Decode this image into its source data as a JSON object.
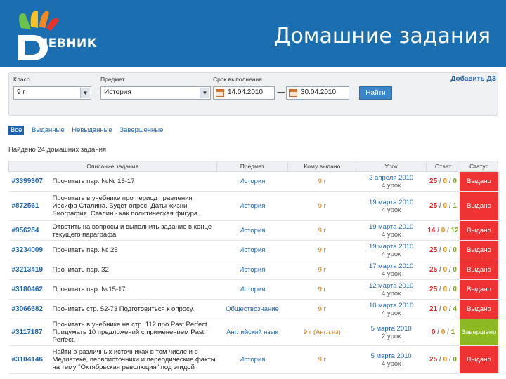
{
  "header": {
    "logo_text": "НЕВНИК",
    "logo_letter": "Д",
    "title": "Домашние задания"
  },
  "filter": {
    "class_label": "Класс",
    "class_value": "9 г",
    "subject_label": "Предмет",
    "subject_value": "История",
    "deadline_label": "Срок выполнения",
    "date_from": "14.04.2010",
    "date_to": "30.04.2010",
    "find_button": "Найти",
    "add_link": "Добавить ДЗ"
  },
  "tabs": [
    {
      "label": "Все",
      "active": true
    },
    {
      "label": "Выданные",
      "active": false
    },
    {
      "label": "Невыданные",
      "active": false
    },
    {
      "label": "Завершенные",
      "active": false
    }
  ],
  "found_text": "Найдено 24 домашних задания",
  "table": {
    "headers": [
      "Описание задания",
      "Предмет",
      "Кому выдано",
      "Урок",
      "Ответ",
      "Статус"
    ],
    "rows": [
      {
        "id": "#3399307",
        "desc": "Прочитать пар. №№ 15-17",
        "subject": "История",
        "who": "9 г",
        "date": "2 апреля 2010",
        "lesson": "4 урок",
        "a": "25",
        "b": "0",
        "c": "0",
        "status": "Выдано"
      },
      {
        "id": "#872561",
        "desc": "Прочитать в учебнике про период правления Иосифа Сталина. Будет опрос. Даты жизни. Биография. Сталин - как политическая фигура.",
        "subject": "История",
        "who": "9 г",
        "date": "19 марта 2010",
        "lesson": "4 урок",
        "a": "25",
        "b": "0",
        "c": "1",
        "status": "Выдано"
      },
      {
        "id": "#956284",
        "desc": "Ответить на вопросы и выполнить задание в конце текущего параграфа",
        "subject": "История",
        "who": "9 г",
        "date": "19 марта 2010",
        "lesson": "4 урок",
        "a": "14",
        "b": "0",
        "c": "12",
        "status": "Выдано"
      },
      {
        "id": "#3234009",
        "desc": "Прочитать пар. № 25",
        "subject": "История",
        "who": "9 г",
        "date": "19 марта 2010",
        "lesson": "4 урок",
        "a": "25",
        "b": "0",
        "c": "0",
        "status": "Выдано"
      },
      {
        "id": "#3213419",
        "desc": "Прочитать пар. 32",
        "subject": "История",
        "who": "9 г",
        "date": "17 марта 2010",
        "lesson": "4 урок",
        "a": "25",
        "b": "0",
        "c": "0",
        "status": "Выдано"
      },
      {
        "id": "#3180462",
        "desc": "Прочитать пар. №15-17",
        "subject": "История",
        "who": "9 г",
        "date": "12 марта 2010",
        "lesson": "4 урок",
        "a": "25",
        "b": "0",
        "c": "0",
        "status": "Выдано"
      },
      {
        "id": "#3066682",
        "desc": "Прочитать стр. 52-73 Подготовиться к опросу.",
        "subject": "Обществознание",
        "who": "9 г",
        "date": "10 марта 2010",
        "lesson": "4 урок",
        "a": "21",
        "b": "0",
        "c": "4",
        "status": "Выдано"
      },
      {
        "id": "#3117187",
        "desc": "Прочитать в учебнике на стр. 112 про Past Perfect. Придумать 10 предложений с применением Past Perfect.",
        "subject": "Английский язык",
        "who": "9 г (Англ.яз)",
        "date": "5 марта 2010",
        "lesson": "2 урок",
        "a": "0",
        "b": "0",
        "c": "1",
        "status": "Завершено"
      },
      {
        "id": "#3104146",
        "desc": "Найти в различных источниках в том числе и в Медиатеке, первоисточники и переодические факты на тему \"Октябрьская революция\" под эгидой",
        "subject": "История",
        "who": "9 г",
        "date": "5 марта 2010",
        "lesson": "4 урок",
        "a": "25",
        "b": "0",
        "c": "0",
        "status": "Выдано"
      }
    ]
  },
  "colors": {
    "header_bg": "#1b6fb0",
    "issued": "#ef3232",
    "completed": "#8cb821",
    "link": "#1e63b0"
  }
}
